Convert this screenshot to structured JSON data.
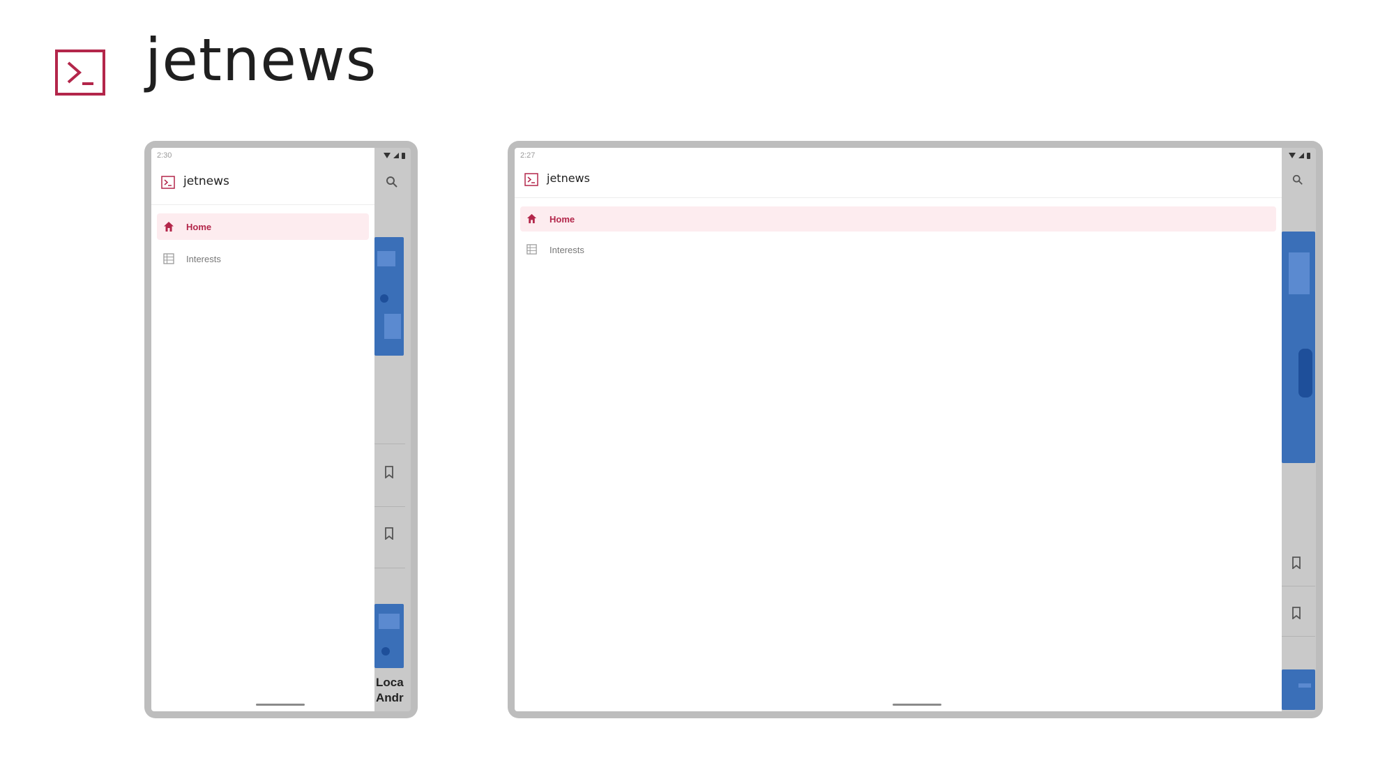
{
  "hero": {
    "title": "jetnews",
    "logo_icon": "terminal-logo-icon"
  },
  "phone": {
    "status_time": "2:30",
    "app_title": "jetnews",
    "nav": [
      {
        "label": "Home",
        "icon": "home-icon",
        "active": true
      },
      {
        "label": "Interests",
        "icon": "list-icon",
        "active": false
      }
    ],
    "bg_text": [
      "Loca",
      "Andr"
    ]
  },
  "tablet": {
    "status_time": "2:27",
    "app_title": "jetnews",
    "nav": [
      {
        "label": "Home",
        "icon": "home-icon",
        "active": true
      },
      {
        "label": "Interests",
        "icon": "list-icon",
        "active": false
      }
    ]
  },
  "colors": {
    "brand": "#b3264a",
    "active_bg": "#fdecef",
    "image_blue": "#3a6fb8"
  }
}
